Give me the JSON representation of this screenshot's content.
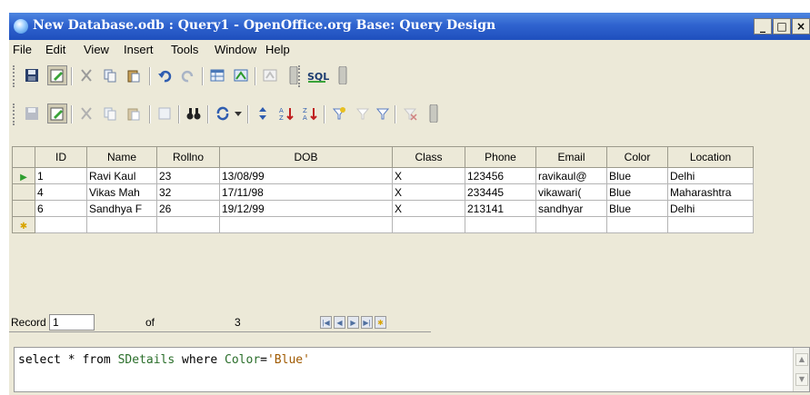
{
  "window": {
    "title": "New Database.odb : Query1 - OpenOffice.org Base: Query Design",
    "min": "_",
    "max": "□",
    "close": "×"
  },
  "menu": [
    {
      "label": "File"
    },
    {
      "label": "Edit"
    },
    {
      "label": "View"
    },
    {
      "label": "Insert"
    },
    {
      "label": "Tools"
    },
    {
      "label": "Window"
    },
    {
      "label": "Help"
    }
  ],
  "toolbar": {
    "sql_label": "SQL"
  },
  "grid": {
    "columns": [
      "ID",
      "Name",
      "Rollno",
      "DOB",
      "Class",
      "Phone",
      "Email",
      "Color",
      "Location"
    ],
    "rows": [
      [
        "1",
        "Ravi Kaul",
        "23",
        "13/08/99",
        "X",
        "123456",
        "ravikaul@",
        "Blue",
        "Delhi"
      ],
      [
        "4",
        "Vikas Mah",
        "32",
        "17/11/98",
        "X",
        "233445",
        "vikawari(",
        "Blue",
        "Maharashtra"
      ],
      [
        "6",
        "Sandhya F",
        "26",
        "19/12/99",
        "X",
        "213141",
        "sandhyar",
        "Blue",
        "Delhi"
      ]
    ]
  },
  "navigator": {
    "record_label": "Record",
    "record_value": "1",
    "of_label": "of",
    "total": "3"
  },
  "sql": {
    "select": "select",
    "star": " * ",
    "from": "from",
    "table": "SDetails",
    "where": "where",
    "column": "Color",
    "eq": "=",
    "value": "'Blue'"
  }
}
